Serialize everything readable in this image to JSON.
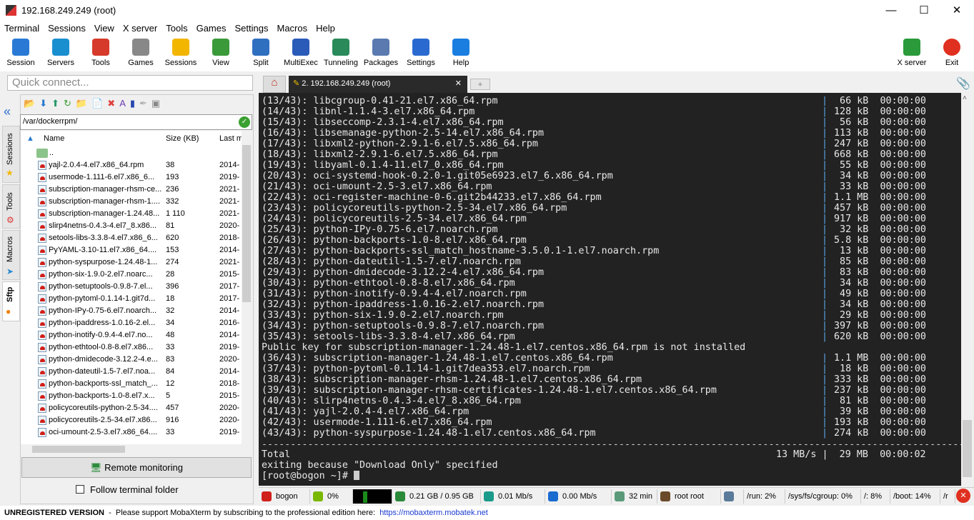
{
  "window": {
    "title": "192.168.249.249 (root)"
  },
  "menu": [
    "Terminal",
    "Sessions",
    "View",
    "X server",
    "Tools",
    "Games",
    "Settings",
    "Macros",
    "Help"
  ],
  "toolbar": [
    {
      "label": "Session",
      "icon": "session-icon",
      "color": "#2a7ad5"
    },
    {
      "label": "Servers",
      "icon": "servers-icon",
      "color": "#1a8fd0"
    },
    {
      "label": "Tools",
      "icon": "tools-icon",
      "color": "#d63a2a"
    },
    {
      "label": "Games",
      "icon": "games-icon",
      "color": "#888"
    },
    {
      "label": "Sessions",
      "icon": "star-icon",
      "color": "#f2b600"
    },
    {
      "label": "View",
      "icon": "view-icon",
      "color": "#3a9a3a"
    },
    {
      "label": "Split",
      "icon": "split-icon",
      "color": "#2f6fc0"
    },
    {
      "label": "MultiExec",
      "icon": "multiexec-icon",
      "color": "#2a5bb8"
    },
    {
      "label": "Tunneling",
      "icon": "tunneling-icon",
      "color": "#2a8a5a"
    },
    {
      "label": "Packages",
      "icon": "packages-icon",
      "color": "#5a7ab0"
    },
    {
      "label": "Settings",
      "icon": "settings-icon",
      "color": "#2a6ad0"
    },
    {
      "label": "Help",
      "icon": "help-icon",
      "color": "#1a7ee0"
    }
  ],
  "toolbar_right": [
    {
      "label": "X server",
      "icon": "xserver-icon",
      "color": "#2a9a3a"
    },
    {
      "label": "Exit",
      "icon": "exit-icon",
      "color": "#e03020"
    }
  ],
  "quick_connect": {
    "placeholder": "Quick connect..."
  },
  "tabs": [
    {
      "label": "2. 192.168.249.249 (root)",
      "active": true
    }
  ],
  "side_tabs": [
    "Sessions",
    "Tools",
    "Macros",
    "Sftp"
  ],
  "sftp": {
    "path": "/var/dockerrpm/",
    "columns": [
      "Name",
      "Size (KB)",
      "Last m"
    ],
    "parent": "..",
    "files": [
      [
        "yajl-2.0.4-4.el7.x86_64.rpm",
        "38",
        "2014-"
      ],
      [
        "usermode-1.111-6.el7.x86_6...",
        "193",
        "2019-"
      ],
      [
        "subscription-manager-rhsm-ce...",
        "236",
        "2021-"
      ],
      [
        "subscription-manager-rhsm-1....",
        "332",
        "2021-"
      ],
      [
        "subscription-manager-1.24.48...",
        "1 110",
        "2021-"
      ],
      [
        "slirp4netns-0.4.3-4.el7_8.x86...",
        "81",
        "2020-"
      ],
      [
        "setools-libs-3.3.8-4.el7.x86_6...",
        "620",
        "2018-"
      ],
      [
        "PyYAML-3.10-11.el7.x86_64....",
        "153",
        "2014-"
      ],
      [
        "python-syspurpose-1.24.48-1...",
        "274",
        "2021-"
      ],
      [
        "python-six-1.9.0-2.el7.noarc...",
        "28",
        "2015-"
      ],
      [
        "python-setuptools-0.9.8-7.el...",
        "396",
        "2017-"
      ],
      [
        "python-pytoml-0.1.14-1.git7d...",
        "18",
        "2017-"
      ],
      [
        "python-IPy-0.75-6.el7.noarch...",
        "32",
        "2014-"
      ],
      [
        "python-ipaddress-1.0.16-2.el...",
        "34",
        "2016-"
      ],
      [
        "python-inotify-0.9.4-4.el7.no...",
        "48",
        "2014-"
      ],
      [
        "python-ethtool-0.8-8.el7.x86...",
        "33",
        "2019-"
      ],
      [
        "python-dmidecode-3.12.2-4.e...",
        "83",
        "2020-"
      ],
      [
        "python-dateutil-1.5-7.el7.noa...",
        "84",
        "2014-"
      ],
      [
        "python-backports-ssl_match_...",
        "12",
        "2018-"
      ],
      [
        "python-backports-1.0-8.el7.x...",
        "5",
        "2015-"
      ],
      [
        "policycoreutils-python-2.5-34....",
        "457",
        "2020-"
      ],
      [
        "policycoreutils-2.5-34.el7.x86...",
        "916",
        "2020-"
      ],
      [
        "oci-umount-2.5-3.el7.x86_64....",
        "33",
        "2019-"
      ]
    ],
    "remote_monitoring": "Remote monitoring",
    "follow_terminal": "Follow terminal folder",
    "follow_checked": false
  },
  "terminal": {
    "lines": [
      [
        "(13/43): libcgroup-0.41-21.el7.x86_64.rpm",
        " 66 kB  00:00:00"
      ],
      [
        "(14/43): libnl-1.1.4-3.el7.x86_64.rpm",
        "128 kB  00:00:00"
      ],
      [
        "(15/43): libseccomp-2.3.1-4.el7.x86_64.rpm",
        " 56 kB  00:00:00"
      ],
      [
        "(16/43): libsemanage-python-2.5-14.el7.x86_64.rpm",
        "113 kB  00:00:00"
      ],
      [
        "(17/43): libxml2-python-2.9.1-6.el7.5.x86_64.rpm",
        "247 kB  00:00:00"
      ],
      [
        "(18/43): libxml2-2.9.1-6.el7.5.x86_64.rpm",
        "668 kB  00:00:00"
      ],
      [
        "(19/43): libyaml-0.1.4-11.el7_0.x86_64.rpm",
        " 55 kB  00:00:00"
      ],
      [
        "(20/43): oci-systemd-hook-0.2.0-1.git05e6923.el7_6.x86_64.rpm",
        " 34 kB  00:00:00"
      ],
      [
        "(21/43): oci-umount-2.5-3.el7.x86_64.rpm",
        " 33 kB  00:00:00"
      ],
      [
        "(22/43): oci-register-machine-0-6.git2b44233.el7.x86_64.rpm",
        "1.1 MB  00:00:00"
      ],
      [
        "(23/43): policycoreutils-python-2.5-34.el7.x86_64.rpm",
        "457 kB  00:00:00"
      ],
      [
        "(24/43): policycoreutils-2.5-34.el7.x86_64.rpm",
        "917 kB  00:00:00"
      ],
      [
        "(25/43): python-IPy-0.75-6.el7.noarch.rpm",
        " 32 kB  00:00:00"
      ],
      [
        "(26/43): python-backports-1.0-8.el7.x86_64.rpm",
        "5.8 kB  00:00:00"
      ],
      [
        "(27/43): python-backports-ssl_match_hostname-3.5.0.1-1.el7.noarch.rpm",
        " 13 kB  00:00:00"
      ],
      [
        "(28/43): python-dateutil-1.5-7.el7.noarch.rpm",
        " 85 kB  00:00:00"
      ],
      [
        "(29/43): python-dmidecode-3.12.2-4.el7.x86_64.rpm",
        " 83 kB  00:00:00"
      ],
      [
        "(30/43): python-ethtool-0.8-8.el7.x86_64.rpm",
        " 34 kB  00:00:00"
      ],
      [
        "(31/43): python-inotify-0.9.4-4.el7.noarch.rpm",
        " 49 kB  00:00:00"
      ],
      [
        "(32/43): python-ipaddress-1.0.16-2.el7.noarch.rpm",
        " 34 kB  00:00:00"
      ],
      [
        "(33/43): python-six-1.9.0-2.el7.noarch.rpm",
        " 29 kB  00:00:00"
      ],
      [
        "(34/43): python-setuptools-0.9.8-7.el7.noarch.rpm",
        "397 kB  00:00:00"
      ],
      [
        "(35/43): setools-libs-3.3.8-4.el7.x86_64.rpm",
        "620 kB  00:00:00"
      ],
      [
        "Public key for subscription-manager-1.24.48-1.el7.centos.x86_64.rpm is not installed",
        ""
      ],
      [
        "(36/43): subscription-manager-1.24.48-1.el7.centos.x86_64.rpm",
        "1.1 MB  00:00:00"
      ],
      [
        "(37/43): python-pytoml-0.1.14-1.git7dea353.el7.noarch.rpm",
        " 18 kB  00:00:00"
      ],
      [
        "(38/43): subscription-manager-rhsm-1.24.48-1.el7.centos.x86_64.rpm",
        "333 kB  00:00:00"
      ],
      [
        "(39/43): subscription-manager-rhsm-certificates-1.24.48-1.el7.centos.x86_64.rpm",
        "237 kB  00:00:00"
      ],
      [
        "(40/43): slirp4netns-0.4.3-4.el7_8.x86_64.rpm",
        " 81 kB  00:00:00"
      ],
      [
        "(41/43): yajl-2.0.4-4.el7.x86_64.rpm",
        " 39 kB  00:00:00"
      ],
      [
        "(42/43): usermode-1.111-6.el7.x86_64.rpm",
        "193 kB  00:00:00"
      ],
      [
        "(43/43): python-syspurpose-1.24.48-1.el7.centos.x86_64.rpm",
        "274 kB  00:00:00"
      ]
    ],
    "separator": "--------------------------------------------------------------------------------------------------------------------------",
    "total_label": "Total",
    "total_right": "13 MB/s |  29 MB  00:00:02",
    "exit_msg": "exiting because \"Download Only\" specified",
    "prompt": "[root@bogon ~]# "
  },
  "status": [
    {
      "icon": "redhat-icon",
      "text": "bogon",
      "color": "#d0201a"
    },
    {
      "icon": "cpu-icon",
      "text": "0%",
      "color": "#7ab800"
    },
    {
      "icon": "cpu-graph",
      "text": "",
      "color": "#1a8a1a"
    },
    {
      "icon": "memory-icon",
      "text": "0.21 GB / 0.95 GB",
      "color": "#2a8a3a"
    },
    {
      "icon": "upload-icon",
      "text": "0.01 Mb/s",
      "color": "#1a9a8a"
    },
    {
      "icon": "download-icon",
      "text": "0.00 Mb/s",
      "color": "#1a6ad0"
    },
    {
      "icon": "uptime-icon",
      "text": "32 min",
      "color": "#5a9a7a"
    },
    {
      "icon": "user-icon",
      "text": "root  root",
      "color": "#6a4a2a"
    },
    {
      "icon": "disk-icon",
      "text": "",
      "color": "#5a7a9a"
    },
    {
      "icon": "",
      "text": "/run: 2%",
      "color": ""
    },
    {
      "icon": "",
      "text": "/sys/fs/cgroup: 0%",
      "color": ""
    },
    {
      "icon": "",
      "text": "/: 8%",
      "color": ""
    },
    {
      "icon": "",
      "text": "/boot: 14%",
      "color": ""
    },
    {
      "icon": "",
      "text": "/r",
      "color": ""
    }
  ],
  "footer": {
    "unregistered": "UNREGISTERED VERSION",
    "message": "  -  Please support MobaXterm by subscribing to the professional edition here:  ",
    "link": "https://mobaxterm.mobatek.net"
  }
}
